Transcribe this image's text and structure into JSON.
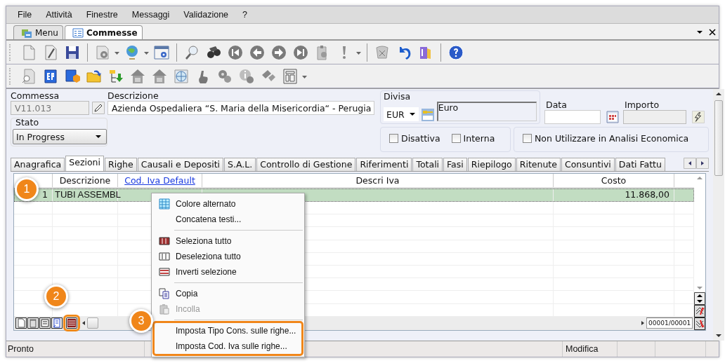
{
  "menu_bar": [
    "File",
    "Attività",
    "Finestre",
    "Messaggi",
    "Validazione",
    "?"
  ],
  "doc_tabs": [
    {
      "label": "Menu",
      "selected": false
    },
    {
      "label": "Commesse",
      "selected": true
    }
  ],
  "header": {
    "commessa": {
      "label": "Commessa",
      "value": "V11.013"
    },
    "descrizione": {
      "label": "Descrizione",
      "value": "Azienda Ospedaliera “S. Maria della Misericordia“ - Perugia"
    },
    "stato": {
      "label": "Stato",
      "value": "In Progress"
    },
    "divisa": {
      "label": "Divisa",
      "code": "EUR",
      "name": "Euro"
    },
    "data": {
      "label": "Data"
    },
    "importo": {
      "label": "Importo"
    },
    "checkboxes": [
      {
        "label": "Disattiva",
        "checked": false
      },
      {
        "label": "Interna",
        "checked": false
      },
      {
        "label": "Non Utilizzare in Analisi Economica",
        "checked": false
      }
    ]
  },
  "section_tabs": [
    {
      "label": "Anagrafica",
      "selected": false
    },
    {
      "label": "Sezioni",
      "selected": true
    },
    {
      "label": "Righe",
      "selected": false
    },
    {
      "label": "Causali e Depositi",
      "selected": false
    },
    {
      "label": "S.A.L.",
      "selected": false
    },
    {
      "label": "Controllo di Gestione",
      "selected": false
    },
    {
      "label": "Riferimenti",
      "selected": false
    },
    {
      "label": "Totali",
      "selected": false
    },
    {
      "label": "Fasi",
      "selected": false
    },
    {
      "label": "Riepilogo",
      "selected": false
    },
    {
      "label": "Ritenute",
      "selected": false
    },
    {
      "label": "Consuntivi",
      "selected": false
    },
    {
      "label": "Dati Fattu",
      "selected": false
    }
  ],
  "table": {
    "columns": [
      "Descrizione",
      "Cod. Iva Default",
      "Descri Iva",
      "Costo"
    ],
    "rows": [
      {
        "index": "1",
        "descrizione": "TUBI ASSEMBL",
        "costo": "11.868,00",
        "selected": true
      }
    ]
  },
  "grid_tools": [
    {
      "highlighted": false
    },
    {
      "highlighted": false
    },
    {
      "highlighted": false
    },
    {
      "highlighted": false
    },
    {
      "highlighted": true
    }
  ],
  "record_counter": "00001/00001",
  "context_menu": {
    "sections": [
      {
        "highlighted": false,
        "items": [
          {
            "label": "Colore alternato",
            "disabled": false
          },
          {
            "label": "Concatena testi...",
            "disabled": false
          }
        ]
      },
      {
        "highlighted": false,
        "items": [
          {
            "label": "Seleziona tutto",
            "disabled": false
          },
          {
            "label": "Deseleziona tutto",
            "disabled": false
          },
          {
            "label": "Inverti selezione",
            "disabled": false
          }
        ]
      },
      {
        "highlighted": false,
        "items": [
          {
            "label": "Copia",
            "disabled": false
          },
          {
            "label": "Incolla",
            "disabled": true
          }
        ]
      },
      {
        "highlighted": true,
        "items": [
          {
            "label": "Imposta Tipo Cons. sulle righe...",
            "disabled": false
          },
          {
            "label": "Imposta Cod. Iva sulle righe...",
            "disabled": false
          }
        ]
      }
    ]
  },
  "callouts": [
    "1",
    "2",
    "3"
  ],
  "status_bar": [
    "Pronto",
    "Modifica"
  ]
}
